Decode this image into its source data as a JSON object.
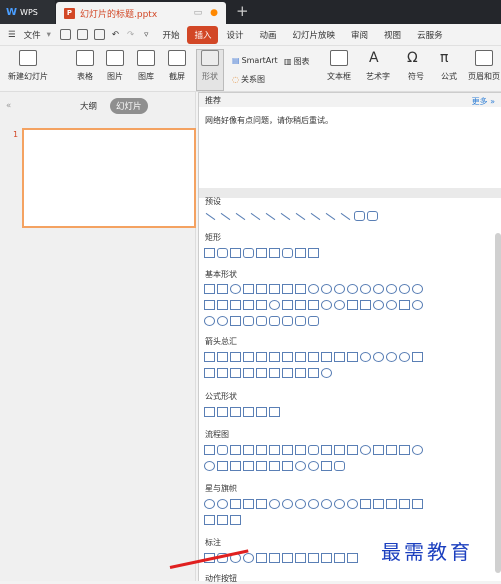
{
  "titlebar": {
    "app": "WPS",
    "doc_title": "幻灯片的标题.pptx"
  },
  "menu": {
    "file": "文件",
    "items": [
      "开始",
      "插入",
      "设计",
      "动画",
      "幻灯片放映",
      "审阅",
      "视图",
      "云服务"
    ],
    "active": "插入"
  },
  "toolbar": {
    "new_slide": "新建幻灯片",
    "table": "表格",
    "picture": "图片",
    "gallery": "图库",
    "screenshot": "截屏",
    "shapes": "形状",
    "smartart": "SmartArt",
    "chart": "图表",
    "relation": "关系图",
    "textbox": "文本框",
    "art": "艺术字",
    "symbol": "符号",
    "formula": "公式",
    "header_footer": "页眉和页"
  },
  "left_pane": {
    "tab_outline": "大纲",
    "tab_slide": "幻灯片",
    "slide_number": "1"
  },
  "dropdown": {
    "recommend_title": "推荐",
    "more": "更多",
    "network_error": "网络好像有点问题，请你稍后重试。",
    "sections": [
      "预设",
      "矩形",
      "基本形状",
      "箭头总汇",
      "公式形状",
      "流程图",
      "星与旗帜",
      "标注",
      "动作按钮"
    ]
  },
  "watermark": "最需教育"
}
